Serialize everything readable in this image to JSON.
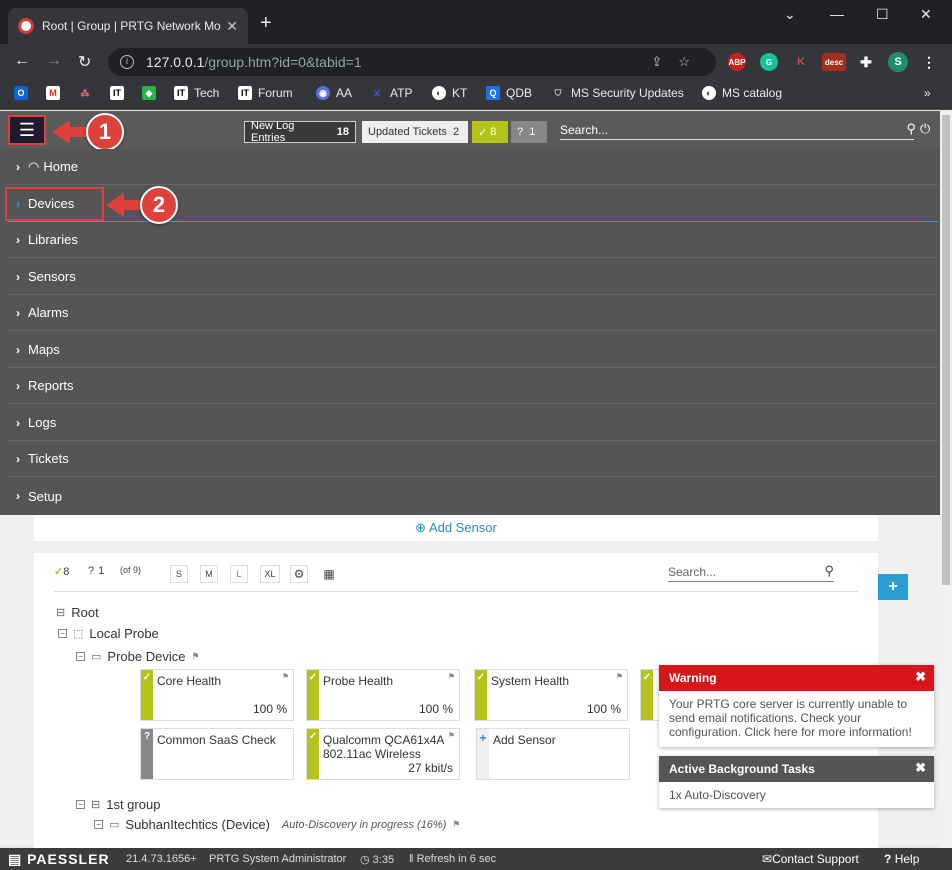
{
  "browser": {
    "tab_title": "Root | Group | PRTG Network Mo",
    "url_host": "127.0.0.1",
    "url_path": "/group.htm?id=0&tabid=1",
    "extensions": [
      "ABP",
      "G",
      "K",
      "desc",
      "S"
    ],
    "bookmarks": [
      "Tech",
      "Forum",
      "AA",
      "ATP",
      "KT",
      "QDB",
      "MS Security Updates",
      "MS catalog"
    ]
  },
  "topbar": {
    "new_log_label": "New Log Entries",
    "new_log_count": "18",
    "updated_tickets_label": "Updated Tickets",
    "updated_tickets_count": "2",
    "ok_count": "8",
    "unknown_count": "1",
    "search_placeholder": "Search..."
  },
  "menu": {
    "items": [
      "Home",
      "Devices",
      "Libraries",
      "Sensors",
      "Alarms",
      "Maps",
      "Reports",
      "Logs",
      "Tickets",
      "Setup"
    ]
  },
  "callouts": [
    "1",
    "2"
  ],
  "content": {
    "add_sensor_top": "Add Sensor",
    "ok_count": "8",
    "unknown_count": "1",
    "of_label": "(of 9)",
    "sizes": [
      "S",
      "M",
      "L",
      "XL"
    ],
    "search_placeholder": "Search...",
    "tree": {
      "root": "Root",
      "probe": "Local Probe",
      "probe_device": "Probe Device",
      "group": "1st group",
      "device": "SubhanItechtics (Device)",
      "discovery": "Auto-Discovery in progress (16%)"
    },
    "tiles": [
      {
        "name": "Core Health",
        "value": "100 %",
        "status": "ok"
      },
      {
        "name": "Probe Health",
        "value": "100 %",
        "status": "ok"
      },
      {
        "name": "System Health",
        "value": "100 %",
        "status": "ok"
      },
      {
        "name": "Common SaaS Check",
        "value": "",
        "status": "unknown"
      },
      {
        "name": "Qualcomm QCA61x4A 802.11ac Wireless",
        "value": "27 kbit/s",
        "status": "ok"
      },
      {
        "name": "Add Sensor",
        "value": "",
        "status": "add"
      }
    ]
  },
  "warning": {
    "title": "Warning",
    "body": "Your PRTG core server is currently unable to send email notifications. Check your configuration. Click here for more information!"
  },
  "background_tasks": {
    "title": "Active Background Tasks",
    "body": "1x Auto-Discovery"
  },
  "footer": {
    "logo": "PAESSLER",
    "version": "21.4.73.1656+",
    "user": "PRTG System Administrator",
    "time": "3:35",
    "refresh": "Refresh in 6 sec",
    "contact": "Contact Support",
    "help": "Help"
  },
  "colors": {
    "ok": "#b4c31a",
    "unknown": "#888888",
    "warning": "#d8151b",
    "accent": "#2a8bc9",
    "callout": "#e0403a"
  }
}
